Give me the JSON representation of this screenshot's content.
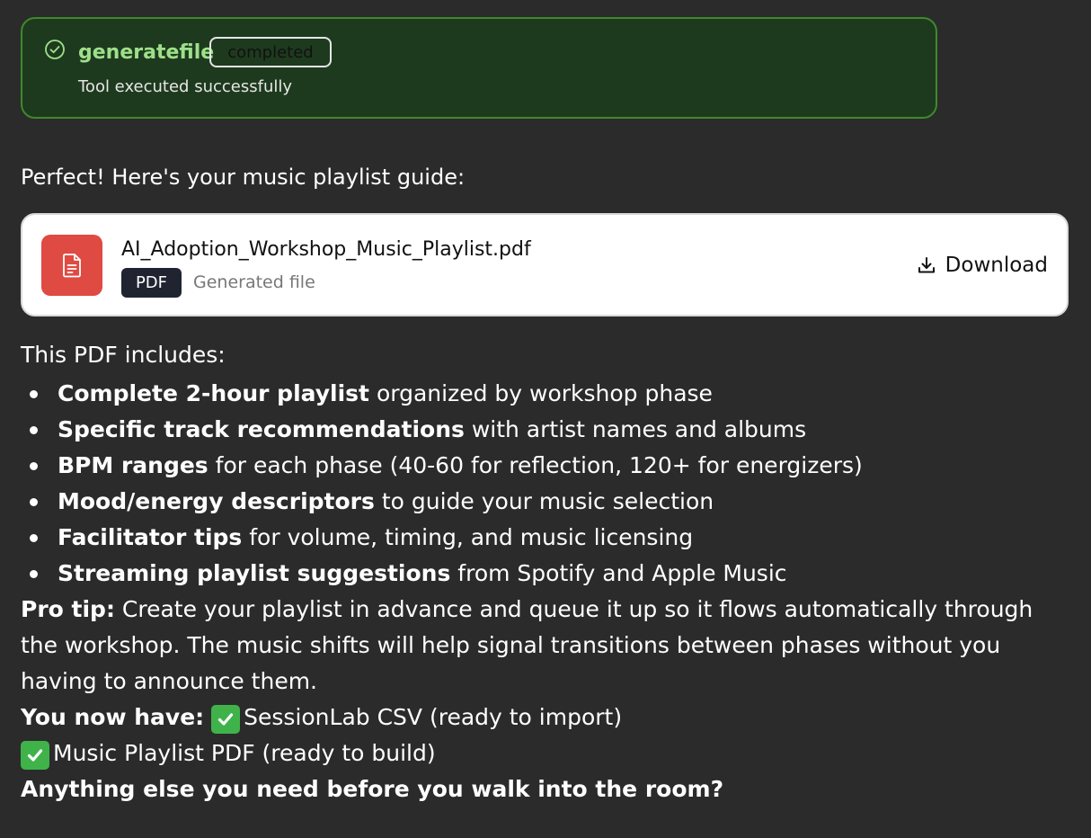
{
  "tool": {
    "name": "generatefile",
    "status": "completed",
    "message": "Tool executed successfully",
    "icon": "check-circle-icon"
  },
  "intro": "Perfect! Here's your music playlist guide:",
  "file": {
    "name": "AI_Adoption_Workshop_Music_Playlist.pdf",
    "type": "PDF",
    "subtitle": "Generated file",
    "download_label": "Download",
    "icon": "document-icon",
    "icon_color": "#df4a42"
  },
  "includes_heading": "This PDF includes:",
  "includes": [
    {
      "bold": "Complete 2-hour playlist",
      "rest": " organized by workshop phase"
    },
    {
      "bold": "Specific track recommendations",
      "rest": " with artist names and albums"
    },
    {
      "bold": "BPM ranges",
      "rest": " for each phase (40-60 for reflection, 120+ for energizers)"
    },
    {
      "bold": "Mood/energy descriptors",
      "rest": " to guide your music selection"
    },
    {
      "bold": "Facilitator tips",
      "rest": " for volume, timing, and music licensing"
    },
    {
      "bold": "Streaming playlist suggestions",
      "rest": " from Spotify and Apple Music"
    }
  ],
  "protip": {
    "label": "Pro tip:",
    "text": " Create your playlist in advance and queue it up so it flows automatically through the workshop. The music shifts will help signal transitions between phases without you having to announce them."
  },
  "you_now_have": {
    "label": "You now have:",
    "item1": "SessionLab CSV (ready to import)",
    "item2": "Music Playlist PDF (ready to build)"
  },
  "closing": "Anything else you need before you walk into the room?",
  "colors": {
    "background": "#2b2b2b",
    "tool_border": "#3e8a2a",
    "tool_name": "#9ee08a",
    "check_emoji": "#3fb34a"
  }
}
